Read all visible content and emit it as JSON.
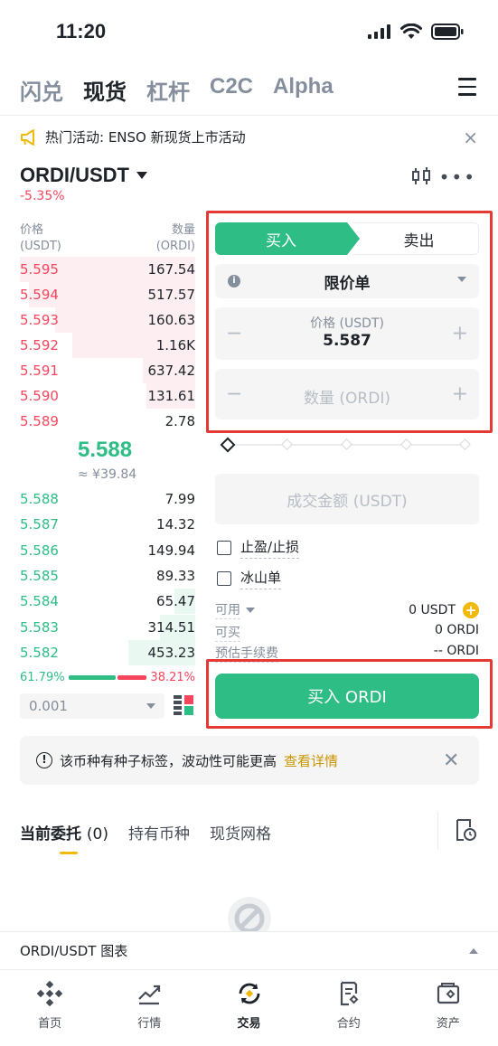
{
  "status": {
    "time": "11:20"
  },
  "topnav": {
    "tabs": [
      "闪兑",
      "现货",
      "杠杆",
      "C2C",
      "Alpha"
    ],
    "active_index": 1
  },
  "announcement": {
    "text": "热门活动: ENSO 新现货上市活动"
  },
  "pair": {
    "name": "ORDI/USDT",
    "change": "-5.35%"
  },
  "orderbook": {
    "price_header": [
      "价格",
      "(USDT)"
    ],
    "qty_header": [
      "数量",
      "(ORDI)"
    ],
    "asks": [
      {
        "price": "5.595",
        "qty": "167.54",
        "depth": 1.0
      },
      {
        "price": "5.594",
        "qty": "517.57",
        "depth": 0.95
      },
      {
        "price": "5.593",
        "qty": "160.63",
        "depth": 0.8
      },
      {
        "price": "5.592",
        "qty": "1.16K",
        "depth": 0.7
      },
      {
        "price": "5.591",
        "qty": "637.42",
        "depth": 0.3
      },
      {
        "price": "5.590",
        "qty": "131.61",
        "depth": 0.28
      },
      {
        "price": "5.589",
        "qty": "2.78",
        "depth": 0.0
      }
    ],
    "mid_price": "5.588",
    "mid_fiat": "≈ ¥39.84",
    "bids": [
      {
        "price": "5.588",
        "qty": "7.99",
        "depth": 0.0
      },
      {
        "price": "5.587",
        "qty": "14.32",
        "depth": 0.0
      },
      {
        "price": "5.586",
        "qty": "149.94",
        "depth": 0.0
      },
      {
        "price": "5.585",
        "qty": "89.33",
        "depth": 0.0
      },
      {
        "price": "5.584",
        "qty": "65.47",
        "depth": 0.12
      },
      {
        "price": "5.583",
        "qty": "314.51",
        "depth": 0.2
      },
      {
        "price": "5.582",
        "qty": "453.23",
        "depth": 0.38
      }
    ],
    "buy_ratio": "61.79%",
    "sell_ratio": "38.21%",
    "buy_ratio_value": 0.6179,
    "precision": "0.001"
  },
  "form": {
    "buy_label": "买入",
    "sell_label": "卖出",
    "order_type": "限价单",
    "price_label": "价格 (USDT)",
    "price_value": "5.587",
    "qty_placeholder": "数量 (ORDI)",
    "amount_placeholder": "成交金额 (USDT)",
    "tp_sl_label": "止盈/止损",
    "iceberg_label": "冰山单",
    "available_label": "可用",
    "available_value": "0 USDT",
    "can_buy_label": "可买",
    "can_buy_value": "0 ORDI",
    "fee_label": "预估手续费",
    "fee_value": "-- ORDI",
    "buy_button": "买入 ORDI"
  },
  "warning": {
    "text": "该币种有种子标签，波动性可能更高",
    "link": "查看详情"
  },
  "order_tabs": {
    "open_label": "当前委托",
    "open_count": "(0)",
    "holdings": "持有币种",
    "grid": "现货网格"
  },
  "chart_bar": {
    "label": "ORDI/USDT 图表"
  },
  "bottom_nav": [
    "首页",
    "行情",
    "交易",
    "合约",
    "资产"
  ],
  "colors": {
    "green": "#2ebd85",
    "red": "#f6465d",
    "highlight": "#e53935",
    "brand": "#f0b90b"
  }
}
